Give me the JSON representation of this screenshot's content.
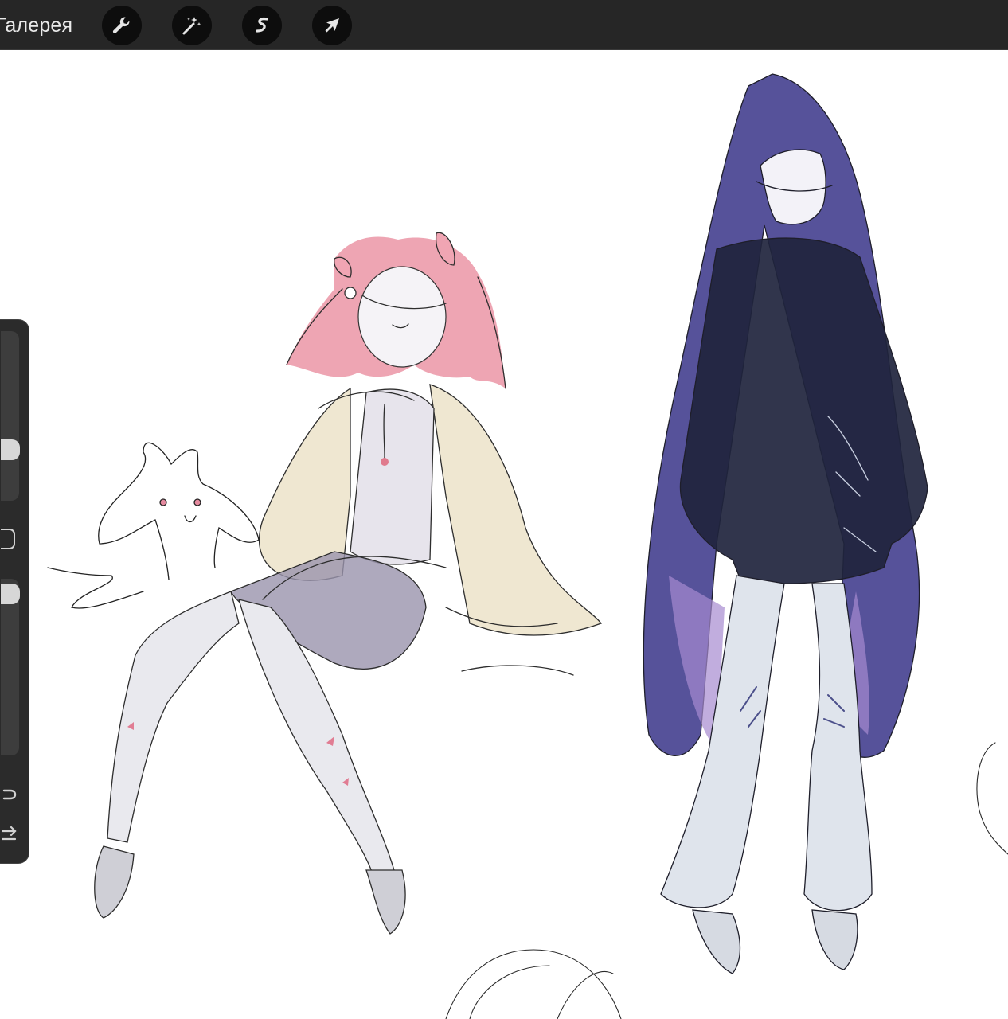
{
  "topbar": {
    "gallery_label": "Галерея",
    "tools": [
      {
        "name": "actions-wrench-icon"
      },
      {
        "name": "adjustments-magic-wand-icon"
      },
      {
        "name": "selection-s-icon"
      },
      {
        "name": "transform-arrow-icon"
      }
    ]
  },
  "sidebar": {
    "brush_size_slider": "brush-size",
    "modify_button": "modify",
    "opacity_slider": "opacity",
    "undo": "undo-icon",
    "redo": "redo-icon"
  },
  "colors": {
    "topbar_bg": "#262626",
    "tool_bg": "#0d0d0d",
    "canvas_bg": "#ffffff",
    "pink_hair": "#e8879a",
    "navy_hair": "#3f3a8c",
    "cardigan": "#ece3c9"
  }
}
